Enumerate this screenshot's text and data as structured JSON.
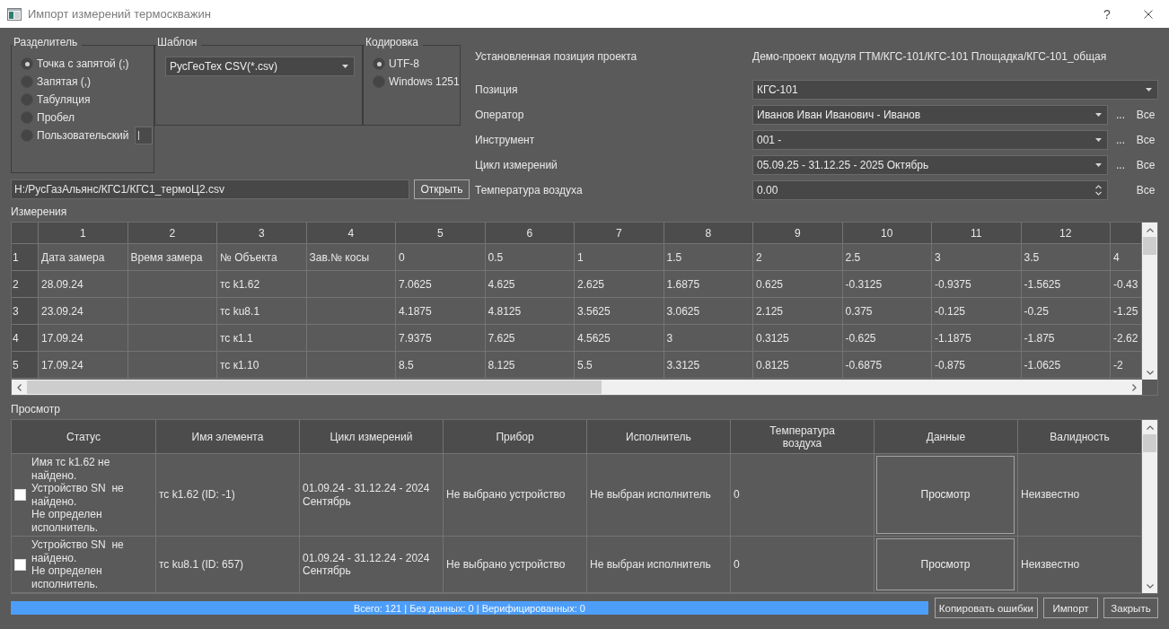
{
  "window": {
    "title": "Импорт измерений термоскважин",
    "help": "?"
  },
  "separator": {
    "title": "Разделитель",
    "options": [
      {
        "label": "Точка с запятой (;)",
        "selected": true
      },
      {
        "label": "Запятая (,)",
        "selected": false
      },
      {
        "label": "Табуляция",
        "selected": false
      },
      {
        "label": "Пробел",
        "selected": false
      },
      {
        "label": "Пользовательский",
        "selected": false,
        "field": {
          "focused": true
        }
      }
    ]
  },
  "template": {
    "title": "Шаблон",
    "value": "РусГеоТех CSV(*.csv)"
  },
  "encoding": {
    "title": "Кодировка",
    "options": [
      {
        "label": "UTF-8",
        "selected": true
      },
      {
        "label": "Windows 1251",
        "selected": false
      }
    ]
  },
  "file": {
    "path": "H:/РусГазАльянс/КГС1/КГС1_термоЦ2.csv",
    "button": "Открыть"
  },
  "project": {
    "label": "Установленная позиция проекта",
    "value": "Демо-проект модуля ГТМ/КГС-101/КГС-101 Площадка/КГС-101_общая"
  },
  "fields": [
    {
      "kind": "combo",
      "label": "Позиция",
      "value": "КГС-101"
    },
    {
      "kind": "combo",
      "label": "Оператор",
      "value": "Иванов Иван Иванович - Иванов",
      "more": "...",
      "all": "Все"
    },
    {
      "kind": "combo",
      "label": "Инструмент",
      "value": "001 -",
      "more": "...",
      "all": "Все"
    },
    {
      "kind": "combo",
      "label": "Цикл измерений",
      "value": "05.09.25 - 31.12.25 - 2025 Октябрь",
      "more": "...",
      "all": "Все"
    },
    {
      "kind": "spin",
      "label": "Температура воздуха",
      "value": "0.00",
      "all": "Все"
    }
  ],
  "measurements": {
    "title": "Измерения",
    "columns": [
      "1",
      "2",
      "3",
      "4",
      "5",
      "6",
      "7",
      "8",
      "9",
      "10",
      "11",
      "12"
    ],
    "rows": [
      {
        "header": "1",
        "cells": [
          "Дата замера",
          "Время замера",
          "№ Объекта",
          "Зав.№ косы",
          "0",
          "0.5",
          "1",
          "1.5",
          "2",
          "2.5",
          "3",
          "3.5",
          "4"
        ]
      },
      {
        "header": "2",
        "cells": [
          "28.09.24",
          null,
          "тс k1.62",
          null,
          "7.0625",
          "4.625",
          "2.625",
          "1.6875",
          "0.625",
          "-0.3125",
          "-0.9375",
          "-1.5625",
          "-0.43"
        ]
      },
      {
        "header": "3",
        "cells": [
          "23.09.24",
          null,
          "тс ku8.1",
          null,
          "4.1875",
          "4.8125",
          "3.5625",
          "3.0625",
          "2.125",
          "0.375",
          "-0.125",
          "-0.25",
          "-1.25"
        ]
      },
      {
        "header": "4",
        "cells": [
          "17.09.24",
          null,
          "тс к1.1",
          null,
          "7.9375",
          "7.625",
          "4.5625",
          "3",
          "0.3125",
          "-0.625",
          "-1.1875",
          "-1.875",
          "-2.62"
        ]
      },
      {
        "header": "5",
        "cells": [
          "17.09.24",
          null,
          "тс к1.10",
          null,
          "8.5",
          "8.125",
          "5.5",
          "3.3125",
          "0.8125",
          "-0.6875",
          "-0.875",
          "-1.0625",
          "-2"
        ]
      }
    ]
  },
  "preview": {
    "title": "Просмотр",
    "columns": [
      "Статус",
      "Имя элемента",
      "Цикл измерений",
      "Прибор",
      "Исполнитель",
      "Температура\nвоздуха",
      "Данные",
      "Валидность"
    ],
    "rows": [
      {
        "checked": false,
        "status": "Имя тс k1.62 не найдено.\nУстройство SN  не найдено.\nНе определен исполнитель.",
        "element": "тс k1.62 (ID: -1)",
        "cycle": "01.09.24 - 31.12.24 - 2024 Сентябрь",
        "device": "Не выбрано устройство",
        "operator": "Не выбран исполнитель",
        "temperature": "0",
        "data": "Просмотр",
        "validity": "Неизвестно"
      },
      {
        "checked": false,
        "status": "Устройство SN  не найдено.\nНе определен исполнитель.",
        "element": "тс ku8.1 (ID: 657)",
        "cycle": "01.09.24 - 31.12.24 - 2024 Сентябрь",
        "device": "Не выбрано устройство",
        "operator": "Не выбран исполнитель",
        "temperature": "0",
        "data": "Просмотр",
        "validity": "Неизвестно"
      }
    ]
  },
  "progress": {
    "level": 1,
    "text": "Всего: 121 | Без данных: 0 | Верифицированных: 0"
  },
  "buttons": [
    "Копировать ошибки",
    "Импорт",
    "Закрыть"
  ]
}
